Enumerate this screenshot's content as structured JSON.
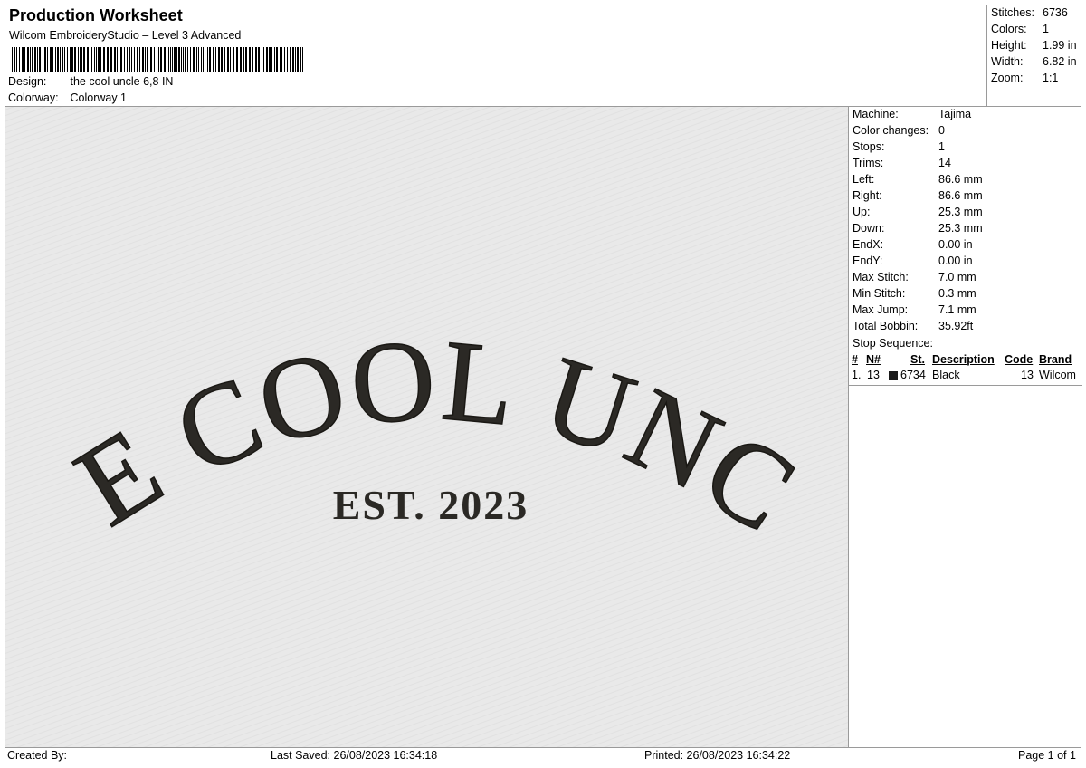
{
  "header": {
    "title": "Production Worksheet",
    "subtitle": "Wilcom EmbroideryStudio – Level 3 Advanced",
    "design_label": "Design:",
    "design_value": "the cool uncle 6,8 IN",
    "colorway_label": "Colorway:",
    "colorway_value": "Colorway 1"
  },
  "summary": {
    "stitches_label": "Stitches:",
    "stitches_value": "6736",
    "colors_label": "Colors:",
    "colors_value": "1",
    "height_label": "Height:",
    "height_value": "1.99 in",
    "width_label": "Width:",
    "width_value": "6.82 in",
    "zoom_label": "Zoom:",
    "zoom_value": "1:1"
  },
  "stats": [
    {
      "label": "Machine:",
      "value": "Tajima"
    },
    {
      "label": "Color changes:",
      "value": "0"
    },
    {
      "label": "Stops:",
      "value": "1"
    },
    {
      "label": "Trims:",
      "value": "14"
    },
    {
      "label": "Left:",
      "value": "86.6 mm"
    },
    {
      "label": "Right:",
      "value": "86.6 mm"
    },
    {
      "label": "Up:",
      "value": "25.3 mm"
    },
    {
      "label": "Down:",
      "value": "25.3 mm"
    },
    {
      "label": "EndX:",
      "value": "0.00 in"
    },
    {
      "label": "EndY:",
      "value": "0.00 in"
    },
    {
      "label": "Max Stitch:",
      "value": "7.0 mm"
    },
    {
      "label": "Min Stitch:",
      "value": "0.3 mm"
    },
    {
      "label": "Max Jump:",
      "value": "7.1 mm"
    },
    {
      "label": "Total Bobbin:",
      "value": "35.92ft"
    }
  ],
  "stop_sequence": {
    "title": "Stop Sequence:",
    "headers": {
      "num": "#",
      "n": "N#",
      "st": "St.",
      "description": "Description",
      "code": "Code",
      "brand": "Brand"
    },
    "rows": [
      {
        "num": "1.",
        "n": "13",
        "st": "6734",
        "description": "Black",
        "code": "13",
        "brand": "Wilcom",
        "color": "#1a1a1a"
      }
    ]
  },
  "design": {
    "main_text": "THE COOL UNCLE",
    "sub_text": "EST. 2023",
    "thread_color": "#2b2925",
    "fabric_color": "#e9e9e9"
  },
  "footer": {
    "created_by": "Created By:",
    "last_saved": "Last Saved: 26/08/2023 16:34:18",
    "printed": "Printed: 26/08/2023 16:34:22",
    "page": "Page 1 of 1"
  }
}
